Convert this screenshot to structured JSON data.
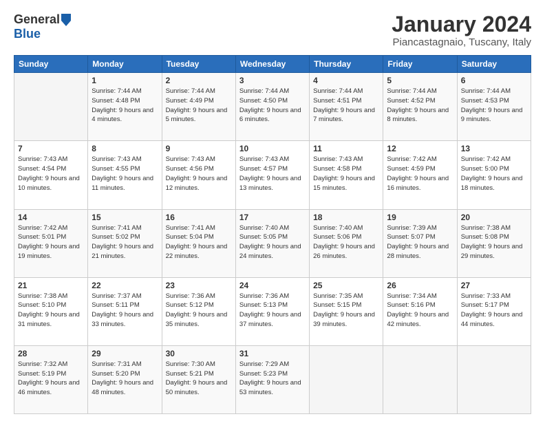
{
  "header": {
    "logo": {
      "general": "General",
      "blue": "Blue"
    },
    "title": "January 2024",
    "subtitle": "Piancastagnaio, Tuscany, Italy"
  },
  "weekdays": [
    "Sunday",
    "Monday",
    "Tuesday",
    "Wednesday",
    "Thursday",
    "Friday",
    "Saturday"
  ],
  "weeks": [
    [
      null,
      {
        "day": 1,
        "sunrise": "7:44 AM",
        "sunset": "4:48 PM",
        "daylight": "9 hours and 4 minutes."
      },
      {
        "day": 2,
        "sunrise": "7:44 AM",
        "sunset": "4:49 PM",
        "daylight": "9 hours and 5 minutes."
      },
      {
        "day": 3,
        "sunrise": "7:44 AM",
        "sunset": "4:50 PM",
        "daylight": "9 hours and 6 minutes."
      },
      {
        "day": 4,
        "sunrise": "7:44 AM",
        "sunset": "4:51 PM",
        "daylight": "9 hours and 7 minutes."
      },
      {
        "day": 5,
        "sunrise": "7:44 AM",
        "sunset": "4:52 PM",
        "daylight": "9 hours and 8 minutes."
      },
      {
        "day": 6,
        "sunrise": "7:44 AM",
        "sunset": "4:53 PM",
        "daylight": "9 hours and 9 minutes."
      }
    ],
    [
      {
        "day": 7,
        "sunrise": "7:43 AM",
        "sunset": "4:54 PM",
        "daylight": "9 hours and 10 minutes."
      },
      {
        "day": 8,
        "sunrise": "7:43 AM",
        "sunset": "4:55 PM",
        "daylight": "9 hours and 11 minutes."
      },
      {
        "day": 9,
        "sunrise": "7:43 AM",
        "sunset": "4:56 PM",
        "daylight": "9 hours and 12 minutes."
      },
      {
        "day": 10,
        "sunrise": "7:43 AM",
        "sunset": "4:57 PM",
        "daylight": "9 hours and 13 minutes."
      },
      {
        "day": 11,
        "sunrise": "7:43 AM",
        "sunset": "4:58 PM",
        "daylight": "9 hours and 15 minutes."
      },
      {
        "day": 12,
        "sunrise": "7:42 AM",
        "sunset": "4:59 PM",
        "daylight": "9 hours and 16 minutes."
      },
      {
        "day": 13,
        "sunrise": "7:42 AM",
        "sunset": "5:00 PM",
        "daylight": "9 hours and 18 minutes."
      }
    ],
    [
      {
        "day": 14,
        "sunrise": "7:42 AM",
        "sunset": "5:01 PM",
        "daylight": "9 hours and 19 minutes."
      },
      {
        "day": 15,
        "sunrise": "7:41 AM",
        "sunset": "5:02 PM",
        "daylight": "9 hours and 21 minutes."
      },
      {
        "day": 16,
        "sunrise": "7:41 AM",
        "sunset": "5:04 PM",
        "daylight": "9 hours and 22 minutes."
      },
      {
        "day": 17,
        "sunrise": "7:40 AM",
        "sunset": "5:05 PM",
        "daylight": "9 hours and 24 minutes."
      },
      {
        "day": 18,
        "sunrise": "7:40 AM",
        "sunset": "5:06 PM",
        "daylight": "9 hours and 26 minutes."
      },
      {
        "day": 19,
        "sunrise": "7:39 AM",
        "sunset": "5:07 PM",
        "daylight": "9 hours and 28 minutes."
      },
      {
        "day": 20,
        "sunrise": "7:38 AM",
        "sunset": "5:08 PM",
        "daylight": "9 hours and 29 minutes."
      }
    ],
    [
      {
        "day": 21,
        "sunrise": "7:38 AM",
        "sunset": "5:10 PM",
        "daylight": "9 hours and 31 minutes."
      },
      {
        "day": 22,
        "sunrise": "7:37 AM",
        "sunset": "5:11 PM",
        "daylight": "9 hours and 33 minutes."
      },
      {
        "day": 23,
        "sunrise": "7:36 AM",
        "sunset": "5:12 PM",
        "daylight": "9 hours and 35 minutes."
      },
      {
        "day": 24,
        "sunrise": "7:36 AM",
        "sunset": "5:13 PM",
        "daylight": "9 hours and 37 minutes."
      },
      {
        "day": 25,
        "sunrise": "7:35 AM",
        "sunset": "5:15 PM",
        "daylight": "9 hours and 39 minutes."
      },
      {
        "day": 26,
        "sunrise": "7:34 AM",
        "sunset": "5:16 PM",
        "daylight": "9 hours and 42 minutes."
      },
      {
        "day": 27,
        "sunrise": "7:33 AM",
        "sunset": "5:17 PM",
        "daylight": "9 hours and 44 minutes."
      }
    ],
    [
      {
        "day": 28,
        "sunrise": "7:32 AM",
        "sunset": "5:19 PM",
        "daylight": "9 hours and 46 minutes."
      },
      {
        "day": 29,
        "sunrise": "7:31 AM",
        "sunset": "5:20 PM",
        "daylight": "9 hours and 48 minutes."
      },
      {
        "day": 30,
        "sunrise": "7:30 AM",
        "sunset": "5:21 PM",
        "daylight": "9 hours and 50 minutes."
      },
      {
        "day": 31,
        "sunrise": "7:29 AM",
        "sunset": "5:23 PM",
        "daylight": "9 hours and 53 minutes."
      },
      null,
      null,
      null
    ]
  ]
}
